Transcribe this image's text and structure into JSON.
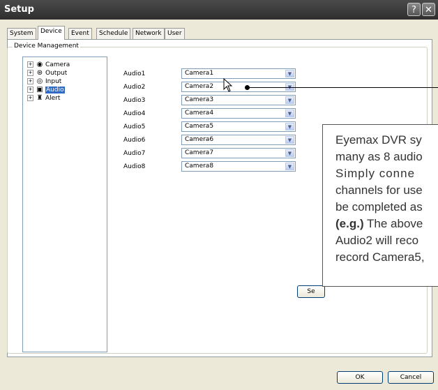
{
  "window": {
    "title": "Setup",
    "help_label": "?",
    "close_label": "✕"
  },
  "tabs": [
    {
      "label": "System"
    },
    {
      "label": "Device"
    },
    {
      "label": "Event"
    },
    {
      "label": "Schedule"
    },
    {
      "label": "Network"
    },
    {
      "label": "User"
    }
  ],
  "active_tab": "Device",
  "group_label": "Device Management",
  "tree": [
    {
      "label": "Camera",
      "icon": "camera-icon"
    },
    {
      "label": "Output",
      "icon": "output-icon"
    },
    {
      "label": "Input",
      "icon": "input-icon"
    },
    {
      "label": "Audio",
      "icon": "audio-icon"
    },
    {
      "label": "Alert",
      "icon": "alert-icon"
    }
  ],
  "tree_selected": "Audio",
  "audio_rows": [
    {
      "label": "Audio1",
      "value": "Camera1"
    },
    {
      "label": "Audio2",
      "value": "Camera2"
    },
    {
      "label": "Audio3",
      "value": "Camera3"
    },
    {
      "label": "Audio4",
      "value": "Camera4"
    },
    {
      "label": "Audio5",
      "value": "Camera5"
    },
    {
      "label": "Audio6",
      "value": "Camera6"
    },
    {
      "label": "Audio7",
      "value": "Camera7"
    },
    {
      "label": "Audio8",
      "value": "Camera8"
    }
  ],
  "set_button_label": "Se",
  "ok_label": "OK",
  "cancel_label": "Cancel",
  "callout_lines": [
    "Eyemax DVR sy",
    "many as 8 audio",
    "Simply  conne",
    "channels for use",
    "be completed as",
    "(e.g.) The above",
    "Audio2 will reco",
    "record Camera5,"
  ],
  "callout_bold_prefix": "(e.g.)",
  "colors": {
    "selection": "#316ac5",
    "titlebar": "#3a3a3a",
    "background": "#ece9d8"
  }
}
